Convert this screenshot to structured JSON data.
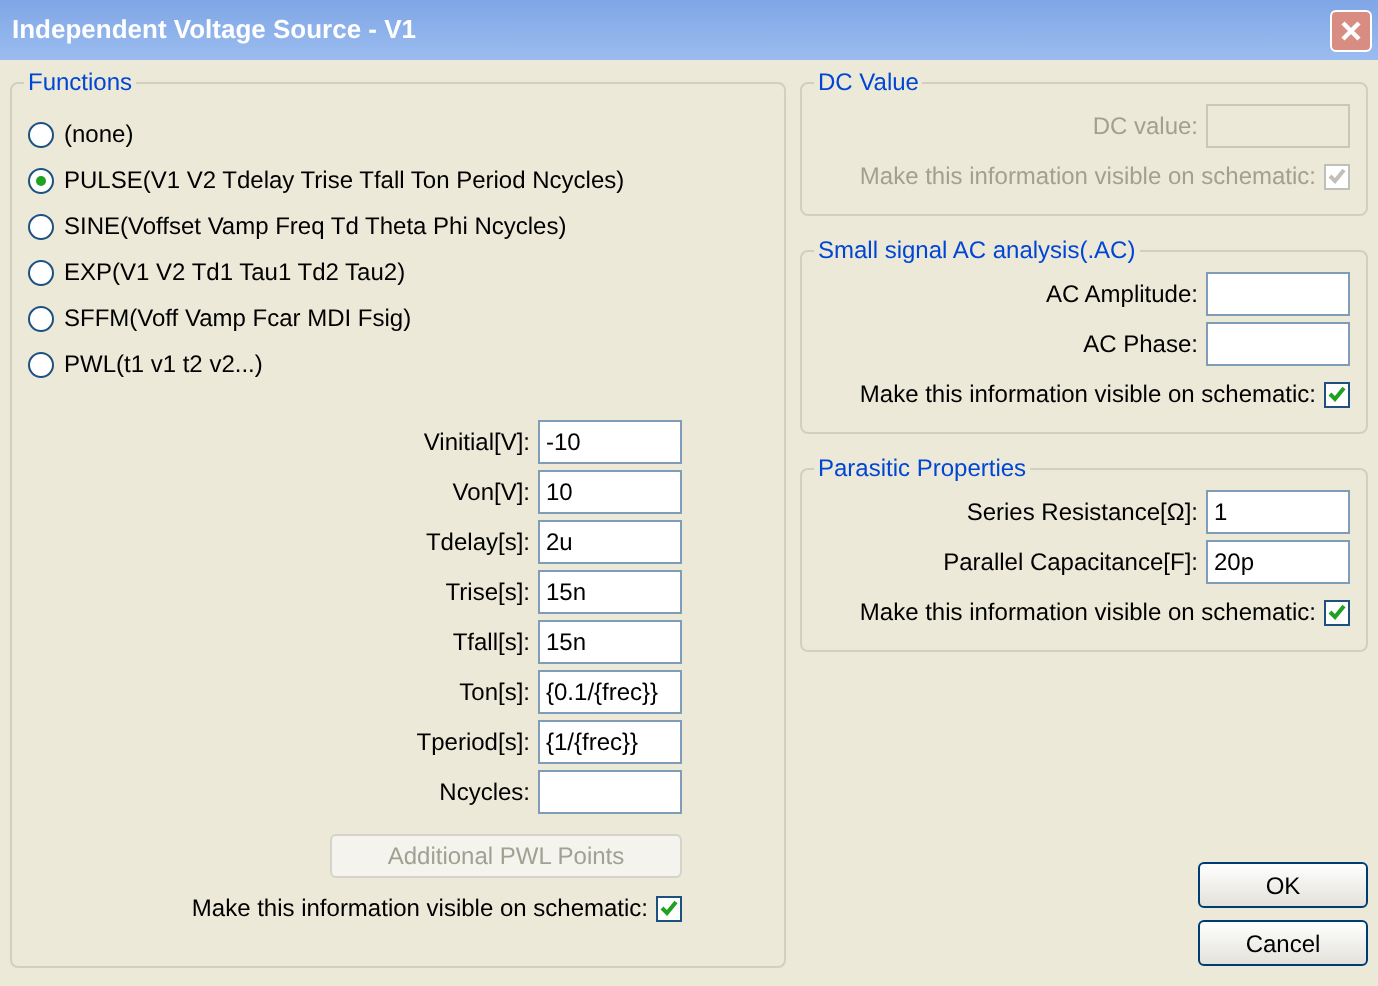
{
  "window": {
    "title": "Independent Voltage Source - V1"
  },
  "functions": {
    "title": "Functions",
    "options": [
      {
        "label": "(none)",
        "selected": false
      },
      {
        "label": "PULSE(V1 V2 Tdelay Trise Tfall Ton Period Ncycles)",
        "selected": true
      },
      {
        "label": "SINE(Voffset Vamp Freq Td Theta Phi Ncycles)",
        "selected": false
      },
      {
        "label": "EXP(V1 V2 Td1 Tau1 Td2 Tau2)",
        "selected": false
      },
      {
        "label": "SFFM(Voff Vamp Fcar MDI Fsig)",
        "selected": false
      },
      {
        "label": "PWL(t1 v1 t2 v2...)",
        "selected": false
      }
    ],
    "params": [
      {
        "label": "Vinitial[V]:",
        "value": "-10"
      },
      {
        "label": "Von[V]:",
        "value": "10"
      },
      {
        "label": "Tdelay[s]:",
        "value": "2u"
      },
      {
        "label": "Trise[s]:",
        "value": "15n"
      },
      {
        "label": "Tfall[s]:",
        "value": "15n"
      },
      {
        "label": "Ton[s]:",
        "value": "{0.1/{frec}}"
      },
      {
        "label": "Tperiod[s]:",
        "value": "{1/{frec}}"
      },
      {
        "label": "Ncycles:"
      }
    ],
    "pwl_button": {
      "label": "Additional PWL Points",
      "disabled": true
    },
    "visible": {
      "label": "Make this information visible on schematic:",
      "checked": true
    }
  },
  "dc_value": {
    "title": "DC Value",
    "disabled": true,
    "fields": [
      {
        "label": "DC value:"
      }
    ],
    "visible": {
      "label": "Make this information visible on schematic:",
      "checked": true
    }
  },
  "ac": {
    "title": "Small signal AC analysis(.AC)",
    "disabled": false,
    "fields": [
      {
        "label": "AC Amplitude:"
      },
      {
        "label": "AC Phase:"
      }
    ],
    "visible": {
      "label": "Make this information visible on schematic:",
      "checked": true
    }
  },
  "parasitic": {
    "title": "Parasitic Properties",
    "disabled": false,
    "fields": [
      {
        "label": "Series Resistance[Ω]:",
        "value": "1"
      },
      {
        "label": "Parallel Capacitance[F]:",
        "value": "20p"
      }
    ],
    "visible": {
      "label": "Make this information visible on schematic:",
      "checked": true
    }
  },
  "buttons": [
    "OK",
    "Cancel"
  ]
}
